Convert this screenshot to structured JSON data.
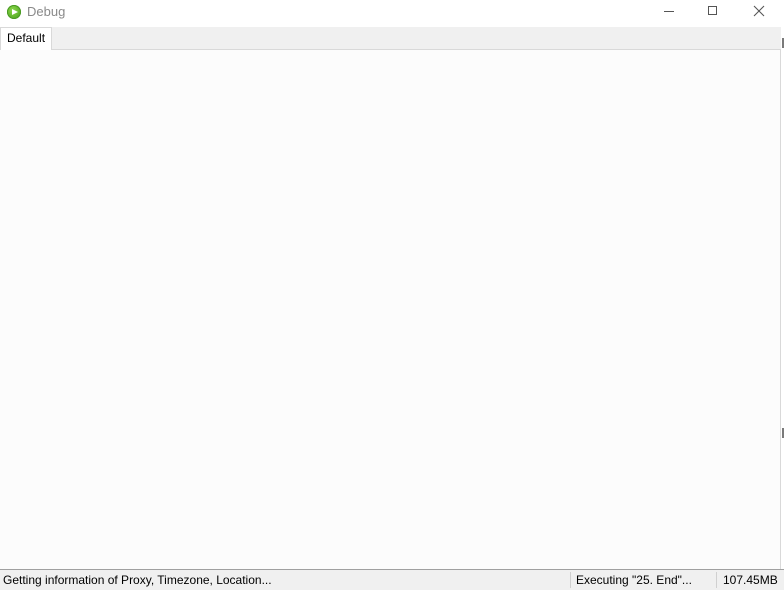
{
  "window": {
    "title": "Debug",
    "app_icon": "play-circle-icon",
    "controls": {
      "minimize_icon": "minimize-icon",
      "maximize_icon": "maximize-icon",
      "close_icon": "close-icon"
    }
  },
  "tabs": [
    {
      "label": "Default",
      "selected": true
    }
  ],
  "status": {
    "message": "Getting information of Proxy, Timezone, Location...",
    "executing": "Executing \"25. End\"...",
    "memory": "107.45MB"
  },
  "colors": {
    "accent_icon": "#5fb32b",
    "title_text": "#8a8a8a",
    "tabstrip_bg": "#f0f0f0",
    "content_bg": "#fcfcfc"
  }
}
